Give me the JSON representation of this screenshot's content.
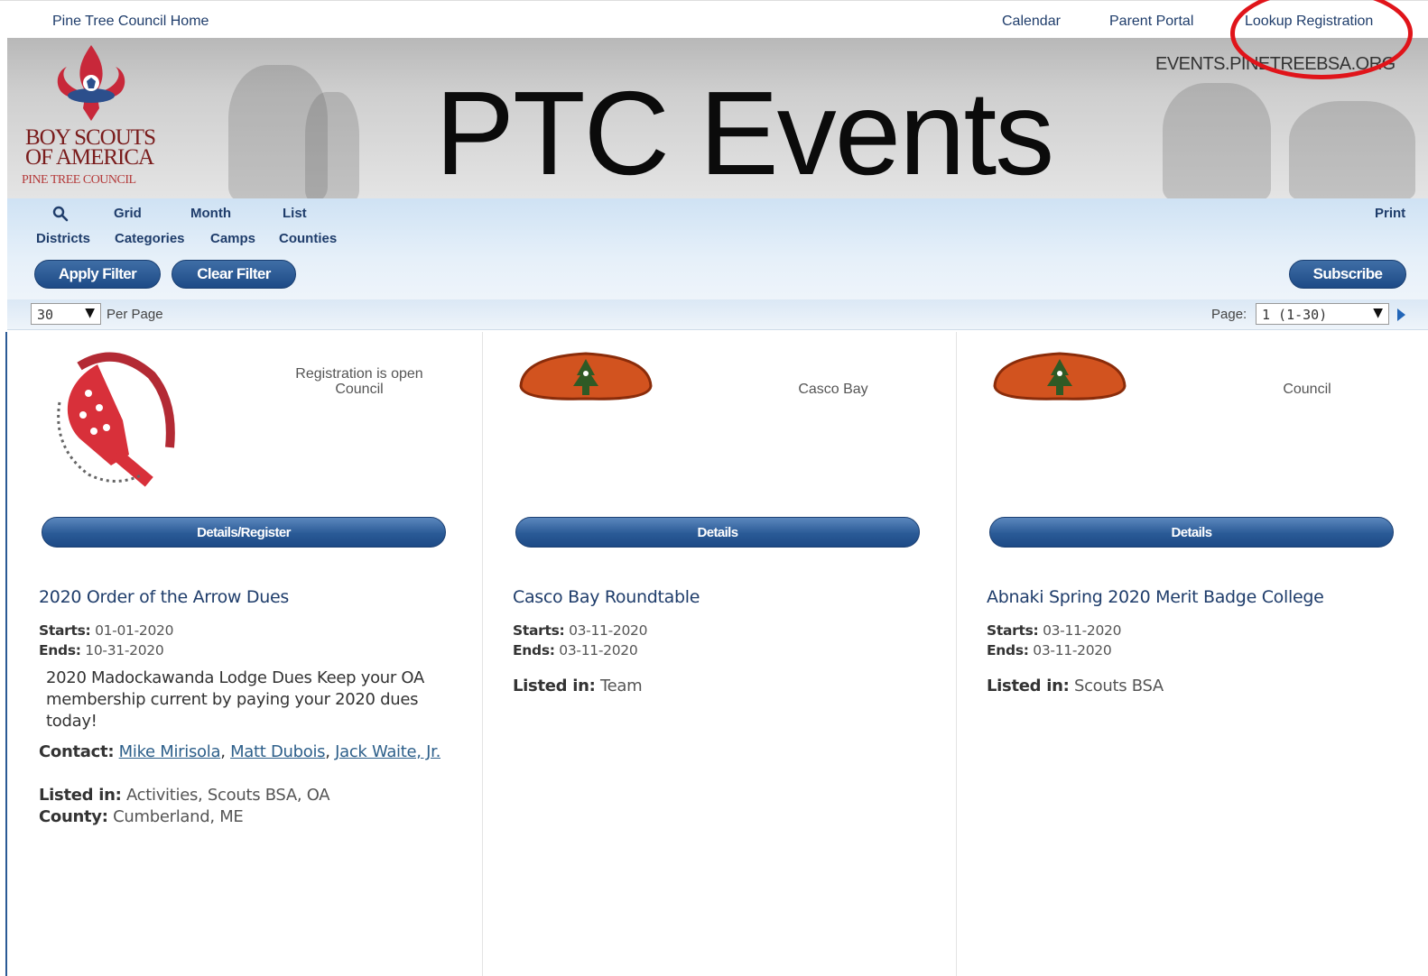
{
  "top_nav": {
    "home": "Pine Tree Council Home",
    "calendar": "Calendar",
    "parent_portal": "Parent Portal",
    "lookup_registration": "Lookup Registration"
  },
  "banner": {
    "site_url": "EVENTS.PINETREEBSA.ORG",
    "title": "PTC Events",
    "logo_line1": "BOY SCOUTS",
    "logo_line2": "OF AMERICA",
    "logo_line3": "PINE TREE COUNCIL"
  },
  "toolbar": {
    "views": [
      "Grid",
      "Month",
      "List"
    ],
    "print": "Print",
    "filters": [
      "Districts",
      "Categories",
      "Camps",
      "Counties"
    ],
    "apply_filter": "Apply Filter",
    "clear_filter": "Clear Filter",
    "subscribe": "Subscribe"
  },
  "paging": {
    "per_page_value": "30",
    "per_page_label": "Per Page",
    "page_label": "Page:",
    "page_value": "1 (1-30)"
  },
  "events": [
    {
      "status": "Registration is open",
      "org": "Council",
      "button": "Details/Register",
      "title": "2020 Order of the Arrow Dues",
      "starts_label": "Starts:",
      "starts": "01-01-2020",
      "ends_label": "Ends:",
      "ends": "10-31-2020",
      "description": "2020 Madockawanda Lodge Dues Keep your OA membership current by paying your 2020 dues today!",
      "contact_label": "Contact:",
      "contacts": [
        "Mike Mirisola",
        "Matt Dubois",
        "Jack Waite, Jr."
      ],
      "listed_label": "Listed in:",
      "listed": "Activities, Scouts BSA, OA",
      "county_label": "County:",
      "county": "Cumberland, ME"
    },
    {
      "org": "Casco Bay",
      "button": "Details",
      "title": "Casco Bay Roundtable",
      "starts_label": "Starts:",
      "starts": "03-11-2020",
      "ends_label": "Ends:",
      "ends": "03-11-2020",
      "listed_label": "Listed in:",
      "listed": "Team"
    },
    {
      "org": "Council",
      "button": "Details",
      "title": "Abnaki Spring 2020 Merit Badge College",
      "starts_label": "Starts:",
      "starts": "03-11-2020",
      "ends_label": "Ends:",
      "ends": "03-11-2020",
      "listed_label": "Listed in:",
      "listed": "Scouts BSA"
    }
  ],
  "colors": {
    "accent": "#1d4a86",
    "link": "#1f3d6b",
    "highlight_circle": "#e0141a"
  }
}
